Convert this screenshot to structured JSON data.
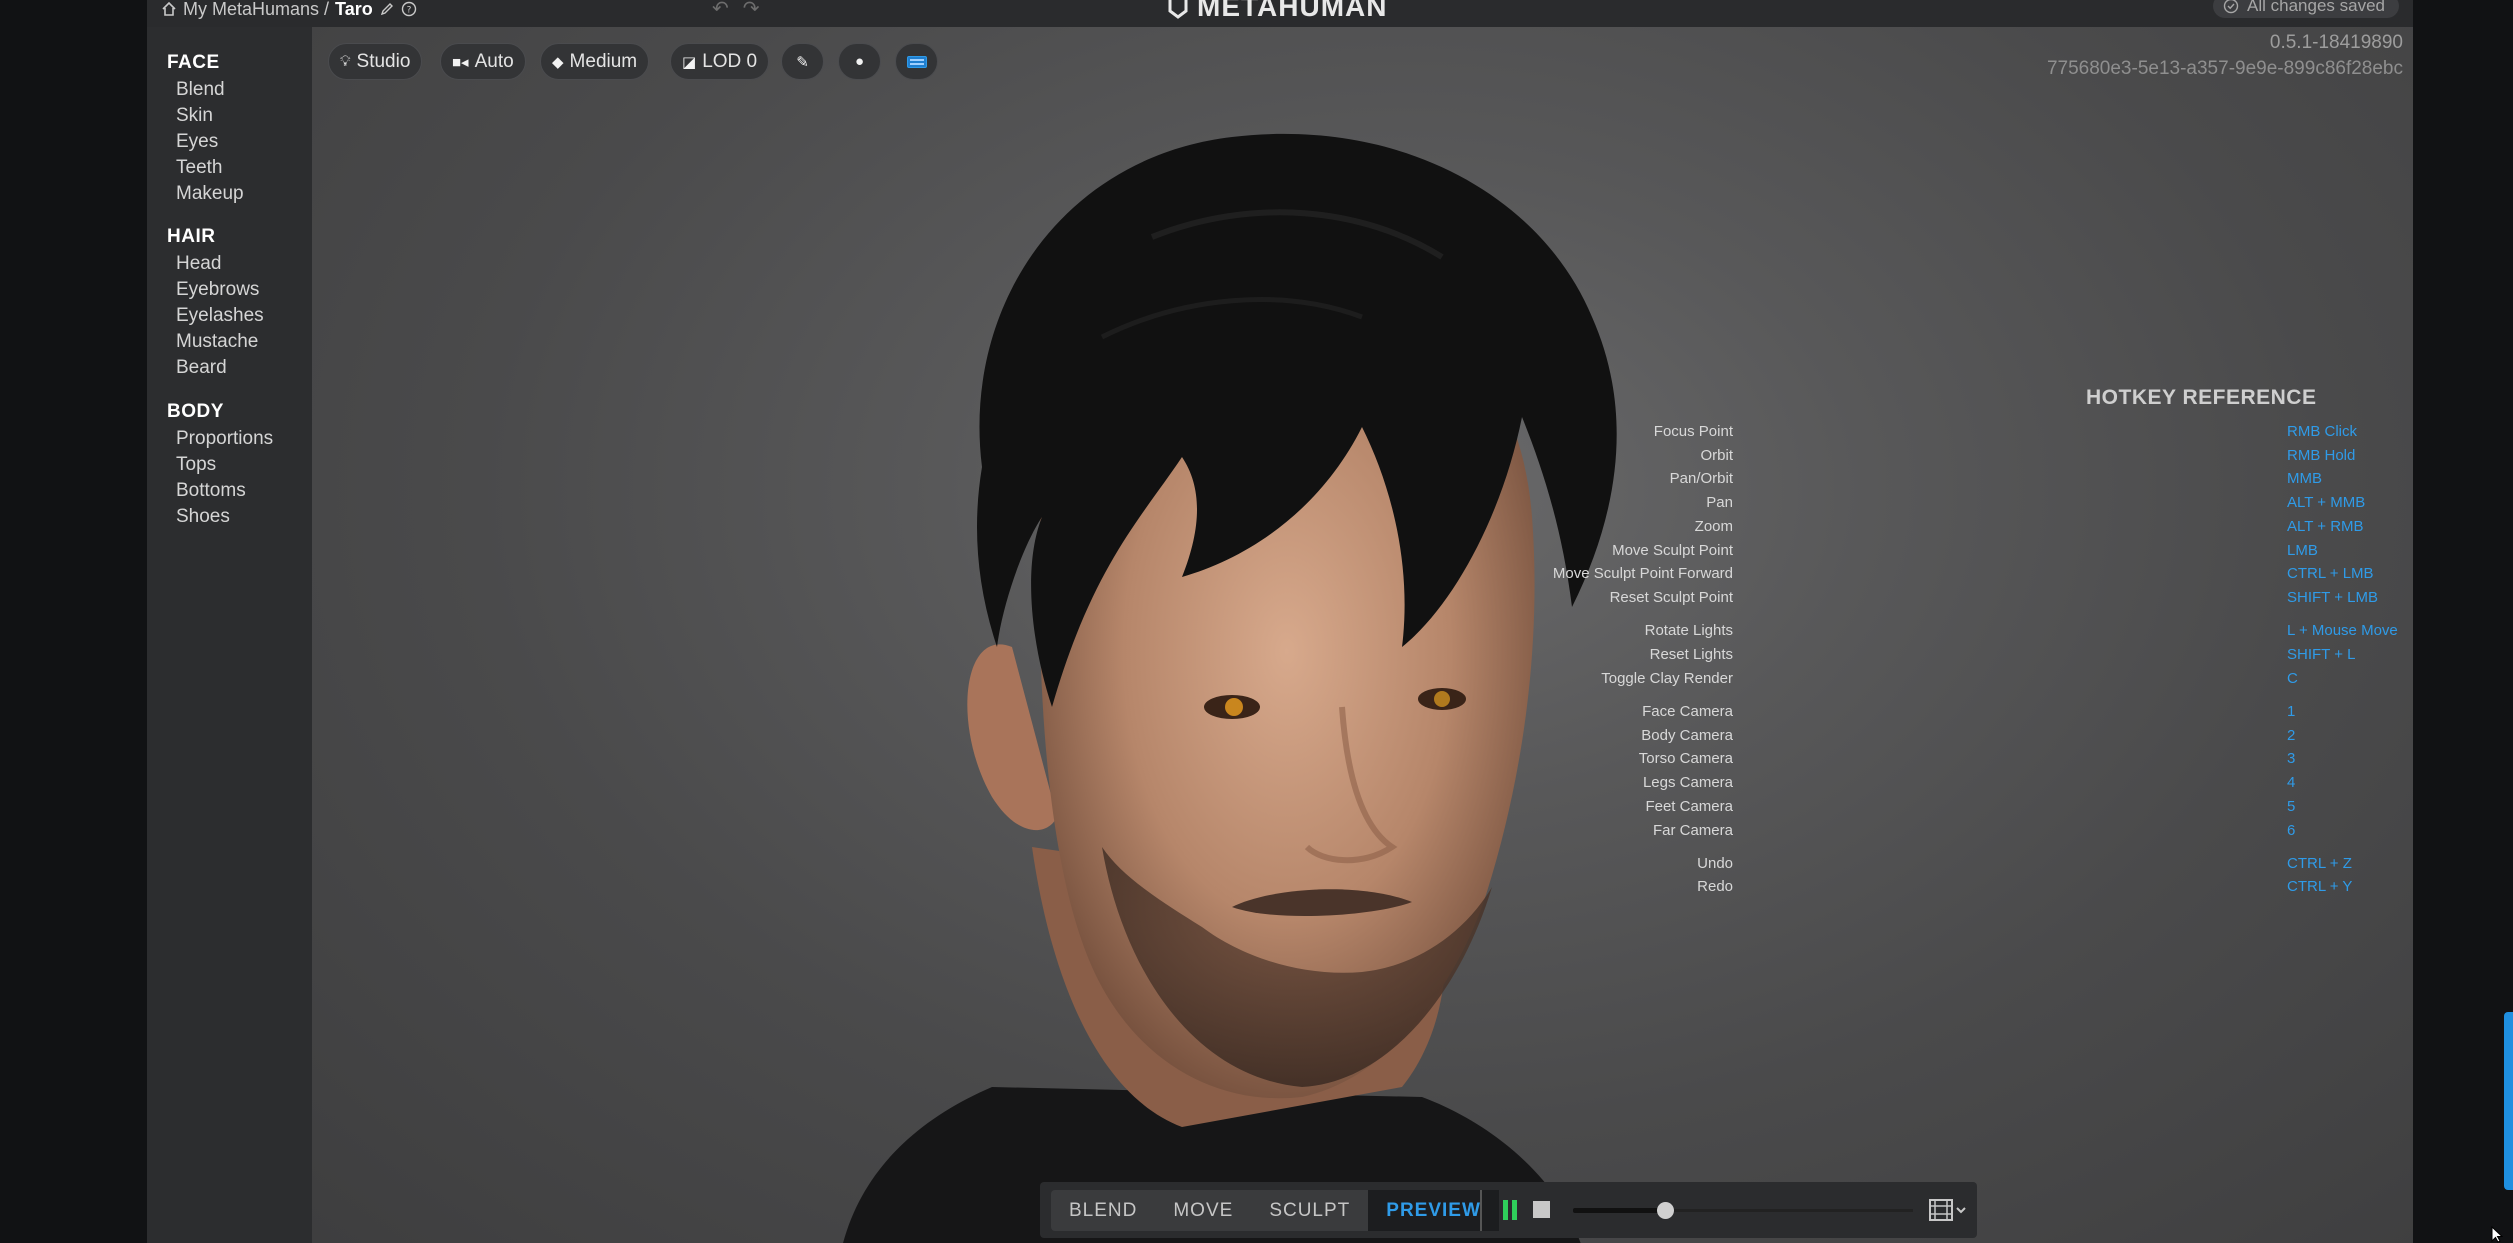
{
  "breadcrumb": {
    "root": "My MetaHumans /",
    "current": "Taro"
  },
  "brand": {
    "name": "METAHUMAN"
  },
  "status": {
    "saved": "All changes saved"
  },
  "build": {
    "version": "0.5.1-18419890",
    "id": "775680e3-5e13-a357-9e9e-899c86f28ebc"
  },
  "sidebar": {
    "sections": [
      {
        "title": "FACE",
        "items": [
          "Blend",
          "Skin",
          "Eyes",
          "Teeth",
          "Makeup"
        ]
      },
      {
        "title": "HAIR",
        "items": [
          "Head",
          "Eyebrows",
          "Eyelashes",
          "Mustache",
          "Beard"
        ]
      },
      {
        "title": "BODY",
        "items": [
          "Proportions",
          "Tops",
          "Bottoms",
          "Shoes"
        ]
      }
    ]
  },
  "viewport_toolbar": {
    "lighting": "Studio",
    "camera": "Auto",
    "quality": "Medium",
    "lod": "LOD 0"
  },
  "hotkeys": {
    "title": "HOTKEY REFERENCE",
    "rows": [
      {
        "label": "Focus Point",
        "key": "RMB Click"
      },
      {
        "label": "Orbit",
        "key": "RMB Hold"
      },
      {
        "label": "Pan/Orbit",
        "key": "MMB"
      },
      {
        "label": "Pan",
        "key": "ALT + MMB"
      },
      {
        "label": "Zoom",
        "key": "ALT + RMB"
      },
      {
        "label": "Move Sculpt Point",
        "key": "LMB"
      },
      {
        "label": "Move Sculpt Point Forward",
        "key": "CTRL + LMB"
      },
      {
        "label": "Reset Sculpt Point",
        "key": "SHIFT + LMB"
      },
      {
        "label": "Rotate Lights",
        "key": "L + Mouse Move"
      },
      {
        "label": "Reset Lights",
        "key": "SHIFT + L"
      },
      {
        "label": "Toggle Clay Render",
        "key": "C"
      },
      {
        "label": "Face Camera",
        "key": "1"
      },
      {
        "label": "Body Camera",
        "key": "2"
      },
      {
        "label": "Torso Camera",
        "key": "3"
      },
      {
        "label": "Legs Camera",
        "key": "4"
      },
      {
        "label": "Feet Camera",
        "key": "5"
      },
      {
        "label": "Far Camera",
        "key": "6"
      },
      {
        "label": "Undo",
        "key": "CTRL + Z"
      },
      {
        "label": "Redo",
        "key": "CTRL + Y"
      }
    ]
  },
  "modes": {
    "items": [
      "BLEND",
      "MOVE",
      "SCULPT",
      "PREVIEW"
    ],
    "active": "PREVIEW"
  },
  "playback": {
    "state": "playing",
    "position": 0.27
  },
  "colors": {
    "accent": "#2f9be8",
    "play": "#2fd05b",
    "panel": "#2c2d2f",
    "viewport": "#4a4a4b"
  },
  "icons": [
    "home-icon",
    "edit-icon",
    "help-icon",
    "undo-icon",
    "redo-icon",
    "check-circle-icon",
    "lightbulb-icon",
    "video-camera-icon",
    "diamond-icon",
    "cube-icon",
    "brush-icon",
    "head-icon",
    "keyboard-icon",
    "pause-icon",
    "stop-icon",
    "film-icon",
    "chevron-down-icon"
  ]
}
